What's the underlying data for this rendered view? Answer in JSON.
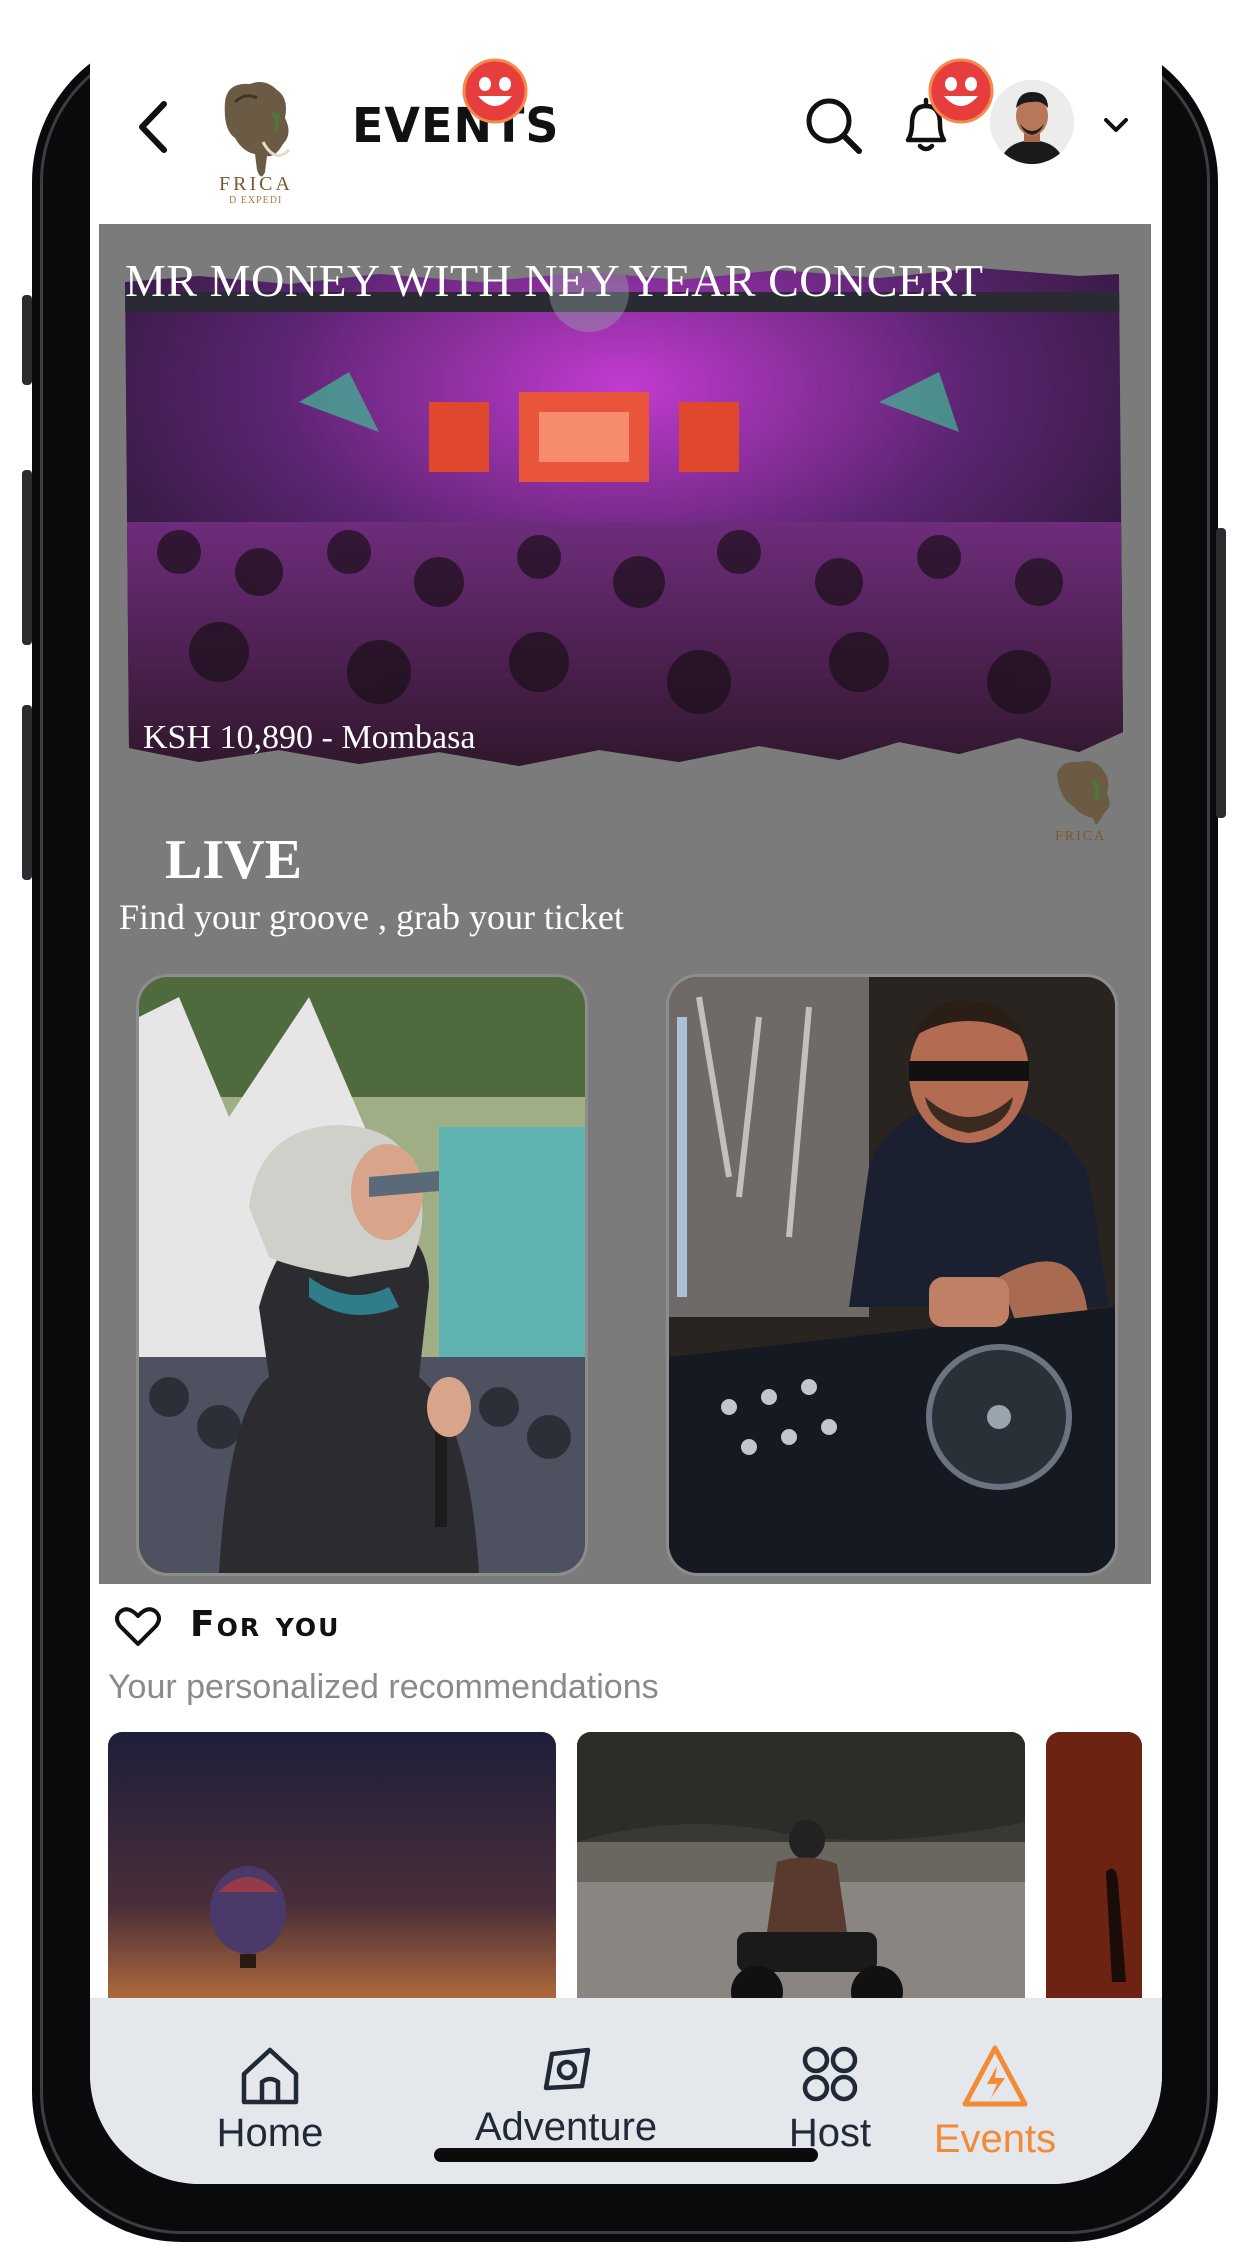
{
  "header": {
    "title": "EVENTS",
    "logo_text": "FRICA",
    "logo_subtext": "D EXPEDI"
  },
  "featured": {
    "title": "MR MONEY WITH NEY YEAR CONCERT",
    "price_location": "KSH 10,890 - Mombasa",
    "badge_text": "FRICA"
  },
  "live": {
    "heading": "LIVE",
    "subtitle": "Find your groove , grab your ticket"
  },
  "for_you": {
    "title": "For you",
    "subtitle": "Your personalized recommendations"
  },
  "tabs": [
    {
      "label": "Home",
      "icon": "home-icon",
      "active": false
    },
    {
      "label": "Adventure",
      "icon": "compass-icon",
      "active": false
    },
    {
      "label": "Host",
      "icon": "grid-icon",
      "active": false
    },
    {
      "label": "Events",
      "icon": "lightning-icon",
      "active": true
    }
  ],
  "colors": {
    "accent": "#f28a36",
    "panel": "#7b7b7b",
    "tabbar": "#e4e7ec"
  }
}
